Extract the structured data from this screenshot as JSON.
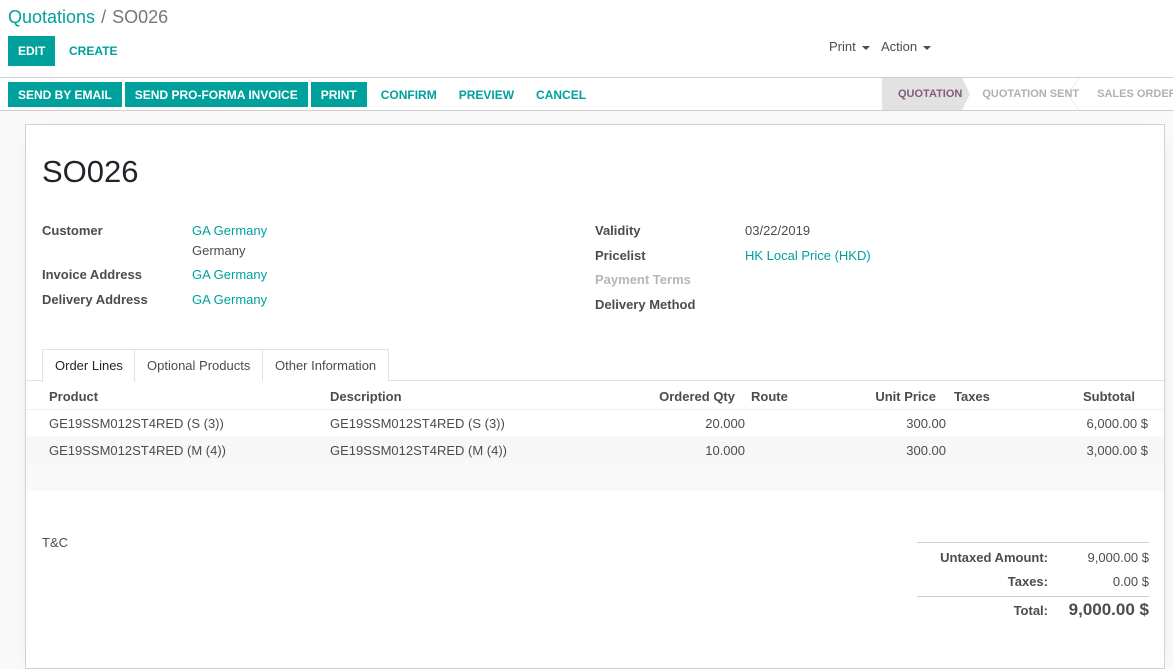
{
  "breadcrumb": {
    "parent": "Quotations",
    "separator": "/",
    "current": "SO026"
  },
  "toolbar": {
    "edit": "EDIT",
    "create": "CREATE",
    "print_menu": "Print",
    "action_menu": "Action"
  },
  "statusbar": {
    "buttons": {
      "send_email": "SEND BY EMAIL",
      "send_proforma": "SEND PRO-FORMA INVOICE",
      "print": "PRINT",
      "confirm": "CONFIRM",
      "preview": "PREVIEW",
      "cancel": "CANCEL"
    },
    "steps": {
      "quotation": "QUOTATION",
      "sent": "QUOTATION SENT",
      "sales": "SALES ORDER"
    }
  },
  "form": {
    "title": "SO026",
    "customer": {
      "label": "Customer",
      "name": "GA Germany",
      "country": "Germany"
    },
    "invoice_address": {
      "label": "Invoice Address",
      "value": "GA Germany"
    },
    "delivery_address": {
      "label": "Delivery Address",
      "value": "GA Germany"
    },
    "validity": {
      "label": "Validity",
      "value": "03/22/2019"
    },
    "pricelist": {
      "label": "Pricelist",
      "value": "HK Local Price (HKD)"
    },
    "payment_terms": {
      "label": "Payment Terms"
    },
    "delivery_method": {
      "label": "Delivery Method"
    }
  },
  "tabs": {
    "order_lines": "Order Lines",
    "optional_products": "Optional Products",
    "other_information": "Other Information"
  },
  "order_lines": {
    "columns": {
      "product": "Product",
      "description": "Description",
      "ordered_qty": "Ordered Qty",
      "route": "Route",
      "unit_price": "Unit Price",
      "taxes": "Taxes",
      "subtotal": "Subtotal"
    },
    "rows": [
      {
        "product": "GE19SSM012ST4RED (S (3))",
        "description": "GE19SSM012ST4RED (S (3))",
        "qty": "20.000",
        "route": "",
        "unit_price": "300.00",
        "taxes": "",
        "subtotal": "6,000.00 $"
      },
      {
        "product": "GE19SSM012ST4RED (M (4))",
        "description": "GE19SSM012ST4RED (M (4))",
        "qty": "10.000",
        "route": "",
        "unit_price": "300.00",
        "taxes": "",
        "subtotal": "3,000.00 $"
      }
    ]
  },
  "footer": {
    "terms": "T&C",
    "untaxed": {
      "label": "Untaxed Amount:",
      "value": "9,000.00 $"
    },
    "taxes": {
      "label": "Taxes:",
      "value": "0.00 $"
    },
    "total": {
      "label": "Total:",
      "value": "9,000.00 $"
    }
  },
  "colors": {
    "brand": "#00a09d",
    "active_step": "#875a7b"
  }
}
